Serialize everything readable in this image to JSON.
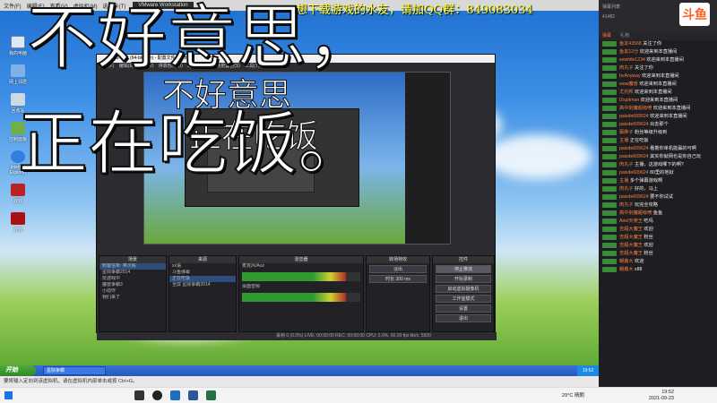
{
  "vm": {
    "menus": [
      "文件(F)",
      "编辑(E)",
      "查看(V)",
      "虚拟机(M)",
      "选项卡(T)"
    ],
    "title": "VMware Workstation"
  },
  "ticker": "想下载游戏的水友，请加QQ群：849083034",
  "desktop_icons": [
    {
      "label": "我的电脑"
    },
    {
      "label": "网上邻居"
    },
    {
      "label": "回收站"
    },
    {
      "label": "控制面板"
    },
    {
      "label": "Internet Explorer"
    },
    {
      "label": "游戏"
    },
    {
      "label": "游戏"
    }
  ],
  "obs": {
    "title": "OBS 27.1 (64-bit, win) - 配置文件: 未命名",
    "menu": "文件(F) 编辑(E) 视图(V) 停靠部件(D) 配置文件(P) 场景集合(S) 工具(T) 帮助(H)",
    "panels": {
      "scenes": {
        "title": "场景",
        "items": [
          "刺客信条: 英灵殿",
          "星际争霸2014",
          "玩游戏中",
          "魔兽争霸3",
          "小动作",
          "我们来了"
        ]
      },
      "sources": {
        "title": "来源",
        "items": [
          "xx语",
          "斗鱼弹幕",
          "正在吃饭",
          "全屏 星际争霸2014"
        ]
      },
      "mixer": {
        "title": "混音器",
        "channels": [
          "麦克风/Aux",
          "桌面音频"
        ]
      },
      "transitions": {
        "title": "转场特效",
        "items": [
          "淡出",
          "时长 300 ms"
        ]
      },
      "controls": {
        "title": "控件",
        "buttons": [
          "停止推流",
          "开始录制",
          "启动虚拟摄像机",
          "工作室模式",
          "设置",
          "退出"
        ]
      }
    },
    "status": "丢帧 0 (0.0%)   LIVE: 00:00:00   REC: 00:00:00   CPU: 0.0%, 60.00 fps   kb/s: 5500"
  },
  "overlay": {
    "line1": "不好意思，",
    "line2": "正在吃饭。",
    "small1": "不好意思",
    "small2": "正在吃饭"
  },
  "xp": {
    "start": "开始",
    "task": "星际争霸",
    "clock": "19:52"
  },
  "vm_status": "要将输入定向到该虚拟机，请在虚拟机内部单击或按 Ctrl+G。",
  "chat": {
    "label": "弹幕列表",
    "count": "41482",
    "logo": "斗鱼",
    "tabs": [
      "弹幕",
      "礼物"
    ],
    "messages": [
      {
        "name": "鱼友43568",
        "text": "关注了你"
      },
      {
        "name": "鱼友12分",
        "text": "欢迎来到本直播间"
      },
      {
        "name": "sewhile1234",
        "text": "欢迎来到本直播间"
      },
      {
        "name": "肉丸子",
        "text": "关注了你"
      },
      {
        "name": "bvAnyway",
        "text": "欢迎来到本直播间"
      },
      {
        "name": "wow魔兽",
        "text": "欢迎来到本直播间"
      },
      {
        "name": "尤托邦",
        "text": "欢迎来到本直播间"
      },
      {
        "name": "l2spitman",
        "text": "欢迎来到本直播间"
      },
      {
        "name": "高中剑魔超级喷",
        "text": "欢迎来到本直播间"
      },
      {
        "name": "paisde609524",
        "text": "欢迎来到本直播间"
      },
      {
        "name": "paisde609624",
        "text": "出去那个"
      },
      {
        "name": "蔡胖子",
        "text": "粉丝等级升级到"
      },
      {
        "name": "主播",
        "text": "正在吃饭"
      },
      {
        "name": "paisde609624",
        "text": "看着你单机能赢的可啊"
      },
      {
        "name": "paisde609624",
        "text": "其实你就网也是你自己玩"
      },
      {
        "name": "肉丸子",
        "text": "主播，这游戏哪下的啊?"
      },
      {
        "name": "paisde609624",
        "text": "80里的地狱"
      },
      {
        "name": "主播",
        "text": "多个弹幕游戏啊"
      },
      {
        "name": "肉丸子",
        "text": "好的，马上"
      },
      {
        "name": "paisde609624",
        "text": "要不你试试"
      },
      {
        "name": "肉丸子",
        "text": "玩完全攻略"
      },
      {
        "name": "高中剑魔超级喷",
        "text": "鱼鱼"
      },
      {
        "name": "Ariel天使王",
        "text": "吃吗"
      },
      {
        "name": "吉超大魔王",
        "text": "欢迎"
      },
      {
        "name": "吉超大魔王",
        "text": "粉丝"
      },
      {
        "name": "吉超大魔王",
        "text": "欢迎"
      },
      {
        "name": "吉超大魔王",
        "text": "粉丝"
      },
      {
        "name": "朝鑫大",
        "text": "欢迎"
      },
      {
        "name": "朝鑫大",
        "text": "x88"
      }
    ]
  },
  "win": {
    "clock_time": "19:52",
    "clock_date": "2021-09-23",
    "weather": "29°C 晴朗"
  }
}
